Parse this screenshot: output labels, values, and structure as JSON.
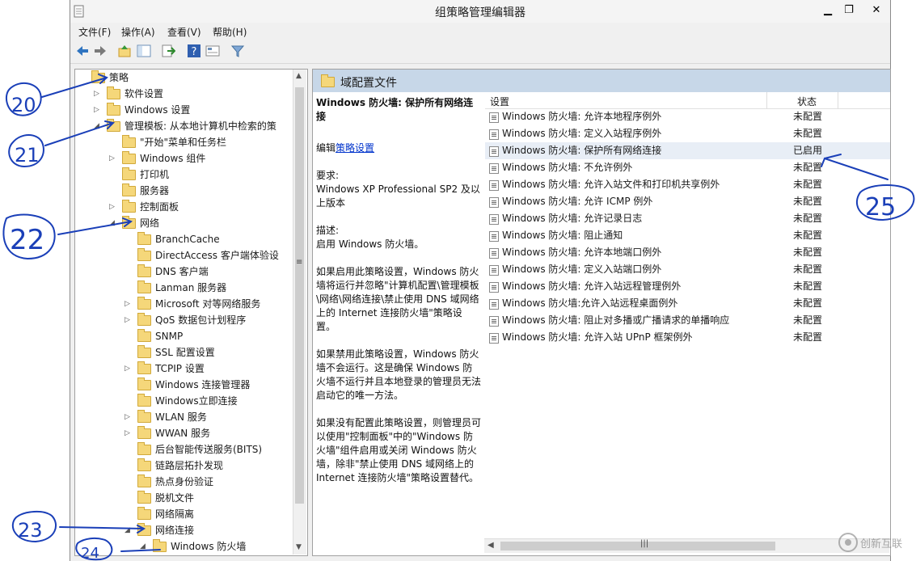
{
  "window": {
    "title": "组策略管理编辑器",
    "minimize": "▁",
    "maximize": "❐",
    "close": "✕"
  },
  "menu": [
    "文件(F)",
    "操作(A)",
    "查看(V)",
    "帮助(H)"
  ],
  "tree": {
    "items": [
      {
        "label": "策略",
        "arrow": ""
      },
      {
        "label": "软件设置",
        "arrow": "▷"
      },
      {
        "label": "Windows 设置",
        "arrow": "▷"
      },
      {
        "label": "管理模板: 从本地计算机中检索的策",
        "arrow": "◢"
      },
      {
        "label": "\"开始\"菜单和任务栏",
        "arrow": ""
      },
      {
        "label": "Windows 组件",
        "arrow": "▷"
      },
      {
        "label": "打印机",
        "arrow": ""
      },
      {
        "label": "服务器",
        "arrow": ""
      },
      {
        "label": "控制面板",
        "arrow": "▷"
      },
      {
        "label": "网络",
        "arrow": "◢"
      },
      {
        "label": "BranchCache",
        "arrow": ""
      },
      {
        "label": "DirectAccess 客户端体验设",
        "arrow": ""
      },
      {
        "label": "DNS 客户端",
        "arrow": ""
      },
      {
        "label": "Lanman 服务器",
        "arrow": ""
      },
      {
        "label": "Microsoft 对等网络服务",
        "arrow": "▷"
      },
      {
        "label": "QoS 数据包计划程序",
        "arrow": "▷"
      },
      {
        "label": "SNMP",
        "arrow": ""
      },
      {
        "label": "SSL 配置设置",
        "arrow": ""
      },
      {
        "label": "TCPIP 设置",
        "arrow": "▷"
      },
      {
        "label": "Windows 连接管理器",
        "arrow": ""
      },
      {
        "label": "Windows立即连接",
        "arrow": ""
      },
      {
        "label": "WLAN 服务",
        "arrow": "▷"
      },
      {
        "label": "WWAN 服务",
        "arrow": "▷"
      },
      {
        "label": "后台智能传送服务(BITS)",
        "arrow": ""
      },
      {
        "label": "链路层拓扑发现",
        "arrow": ""
      },
      {
        "label": "热点身份验证",
        "arrow": ""
      },
      {
        "label": "脱机文件",
        "arrow": ""
      },
      {
        "label": "网络隔离",
        "arrow": ""
      },
      {
        "label": "网络连接",
        "arrow": "◢"
      },
      {
        "label": "Windows 防火墙",
        "arrow": "◢"
      }
    ]
  },
  "right": {
    "header": "域配置文件",
    "policy_title": "Windows 防火墙: 保护所有网络连接",
    "edit_prefix": "编辑",
    "edit_link": "策略设置",
    "requirements": "要求:\nWindows XP Professional SP2 及以上版本",
    "description_label": "描述:",
    "description": "启用 Windows 防火墙。",
    "p_enabled": "如果启用此策略设置，Windows 防火墙将运行并忽略\"计算机配置\\管理模板\\网络\\网络连接\\禁止使用 DNS 域网络上的 Internet 连接防火墙\"策略设置。",
    "p_disabled": "如果禁用此策略设置，Windows 防火墙不会运行。这是确保 Windows 防火墙不运行并且本地登录的管理员无法启动它的唯一方法。",
    "p_notconfigured": "如果没有配置此策略设置，则管理员可以使用\"控制面板\"中的\"Windows 防火墙\"组件启用或关闭 Windows 防火墙，除非\"禁止使用 DNS 域网络上的 Internet 连接防火墙\"策略设置替代。",
    "col_setting": "设置",
    "col_state": "状态",
    "rows": [
      {
        "name": "Windows 防火墙: 允许本地程序例外",
        "state": "未配置"
      },
      {
        "name": "Windows 防火墙: 定义入站程序例外",
        "state": "未配置"
      },
      {
        "name": "Windows 防火墙: 保护所有网络连接",
        "state": "已启用"
      },
      {
        "name": "Windows 防火墙: 不允许例外",
        "state": "未配置"
      },
      {
        "name": "Windows 防火墙: 允许入站文件和打印机共享例外",
        "state": "未配置"
      },
      {
        "name": "Windows 防火墙: 允许 ICMP 例外",
        "state": "未配置"
      },
      {
        "name": "Windows 防火墙: 允许记录日志",
        "state": "未配置"
      },
      {
        "name": "Windows 防火墙: 阻止通知",
        "state": "未配置"
      },
      {
        "name": "Windows 防火墙: 允许本地端口例外",
        "state": "未配置"
      },
      {
        "name": "Windows 防火墙: 定义入站端口例外",
        "state": "未配置"
      },
      {
        "name": "Windows 防火墙: 允许入站远程管理例外",
        "state": "未配置"
      },
      {
        "name": "Windows 防火墙:允许入站远程桌面例外",
        "state": "未配置"
      },
      {
        "name": "Windows 防火墙: 阻止对多播或广播请求的单播响应",
        "state": "未配置"
      },
      {
        "name": "Windows 防火墙: 允许入站 UPnP 框架例外",
        "state": "未配置"
      }
    ]
  },
  "annotations": [
    "20",
    "21",
    "22",
    "23",
    "24",
    "25"
  ],
  "watermark": "创新互联",
  "colors": {
    "ink": "#1a3fb8",
    "header_bg": "#c7d7e8",
    "folder": "#f5d77a"
  }
}
